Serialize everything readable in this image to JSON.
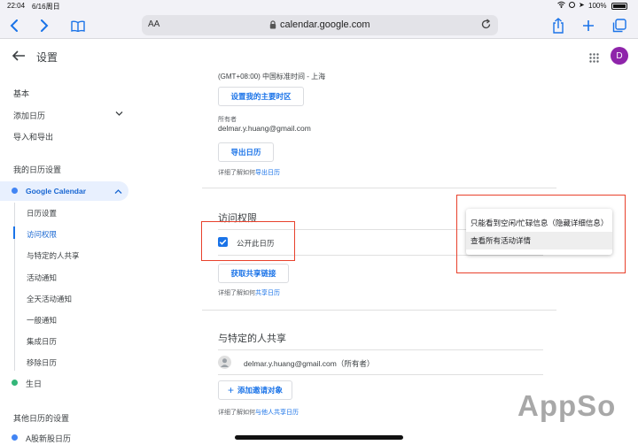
{
  "statusbar": {
    "time": "22:04",
    "date": "6/16周日",
    "battery": "100%"
  },
  "browser": {
    "text_size_label": "AA",
    "url": "calendar.google.com"
  },
  "header": {
    "title": "设置",
    "avatar_letter": "D"
  },
  "sidebar": {
    "general": "基本",
    "add_calendar": "添加日历",
    "import_export": "导入和导出",
    "my_settings_heading": "我的日历设置",
    "calendar_name": "Google Calendar",
    "sub_items": [
      "日历设置",
      "访问权限",
      "与特定的人共享",
      "活动通知",
      "全天活动通知",
      "一般通知",
      "集成日历",
      "移除日历"
    ],
    "birthday": "生日",
    "other_settings_heading": "其他日历的设置",
    "other_calendar": "A股新股日历"
  },
  "main": {
    "timezone_text": "(GMT+08:00) 中国标准时间 - 上海",
    "set_timezone_button": "设置我的主要时区",
    "owner_label": "所有者",
    "owner_email": "delmar.y.huang@gmail.com",
    "export_button": "导出日历",
    "export_help_prefix": "详细了解如何",
    "export_help_link": "导出日历",
    "access_title": "访问权限",
    "public_checkbox_label": "公开此日历",
    "share_link_button": "获取共享链接",
    "share_help_prefix": "详细了解如何",
    "share_help_link": "共享日历",
    "share_specific_title": "与特定的人共享",
    "shared_person": "delmar.y.huang@gmail.com（所有者）",
    "add_people_button": "添加邀请对象",
    "add_people_help_prefix": "详细了解如何",
    "add_people_help_link": "与他人共享日历"
  },
  "popup_menu": {
    "options": [
      "只能看到空闲/忙碌信息（隐藏详细信息）",
      "查看所有活动详情"
    ]
  },
  "watermark": "AppSo",
  "colors": {
    "accent": "#1a73e8",
    "highlight_box": "#e8412c",
    "calendar_dot": "#4285f4",
    "birthday_dot": "#33b679",
    "avatar": "#8e24aa"
  }
}
